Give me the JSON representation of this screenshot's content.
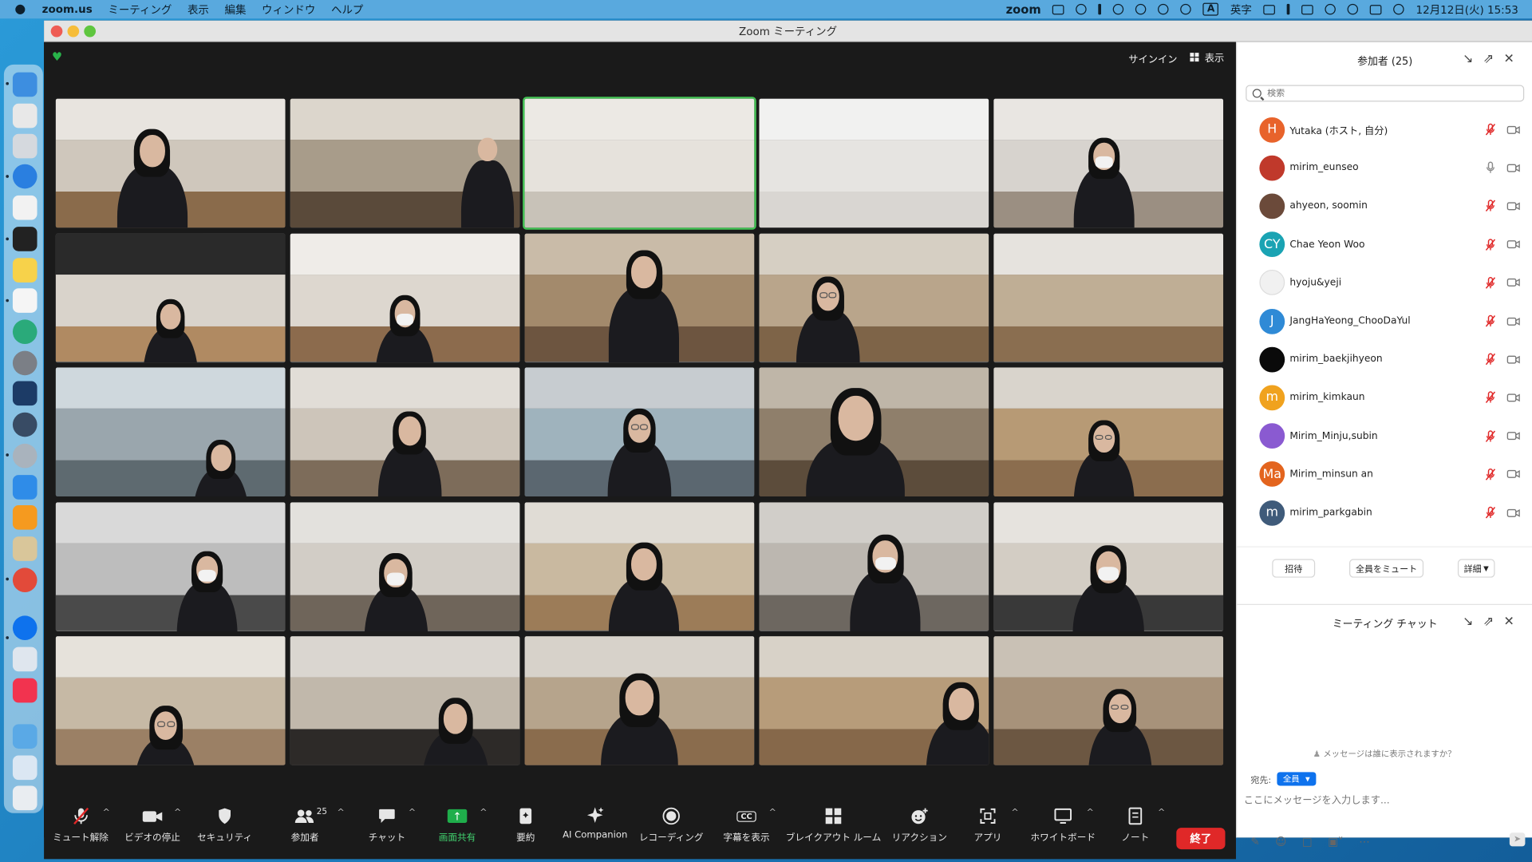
{
  "menubar": {
    "app": "zoom.us",
    "items": [
      "ミーティング",
      "表示",
      "編集",
      "ウィンドウ",
      "ヘルプ"
    ],
    "zoom_label": "zoom",
    "ime_label": "A",
    "ime_text": "英字",
    "datetime": "12月12日(火)  15:53"
  },
  "window": {
    "title": "Zoom ミーティング"
  },
  "video": {
    "signin": "サインイン",
    "view": "表示"
  },
  "toolbar": {
    "mute": "ミュート解除",
    "video": "ビデオの停止",
    "security": "セキュリティ",
    "participants": "参加者",
    "participants_count": "25",
    "chat": "チャット",
    "share": "画面共有",
    "summary": "要約",
    "ai": "AI Companion",
    "record": "レコーディング",
    "captions": "字幕を表示",
    "captions_icon": "CC",
    "breakout": "ブレイクアウト ルーム",
    "reactions": "リアクション",
    "apps": "アプリ",
    "whiteboard": "ホワイトボード",
    "notes": "ノート",
    "end": "終了"
  },
  "panel": {
    "title": "参加者 (25)",
    "search_placeholder": "検索",
    "participants": [
      {
        "name": "Yutaka (ホスト, 自分)",
        "initials": "H",
        "color": "#e8632b",
        "mic": "muted"
      },
      {
        "name": "mirim_eunseo",
        "initials": "",
        "color": "#c0392b",
        "mic": "on"
      },
      {
        "name": "ahyeon, soomin",
        "initials": "",
        "color": "#6b4a3a",
        "mic": "muted"
      },
      {
        "name": "Chae Yeon Woo",
        "initials": "CY",
        "color": "#1aa3b3",
        "mic": "muted"
      },
      {
        "name": "hyoju&yeji",
        "initials": "",
        "color": "#f1f1f1",
        "mic": "muted"
      },
      {
        "name": "JangHaYeong_ChooDaYul",
        "initials": "J",
        "color": "#2f8ad6",
        "mic": "muted"
      },
      {
        "name": "mirim_baekjihyeon",
        "initials": "",
        "color": "#0a0a0a",
        "mic": "muted"
      },
      {
        "name": "mirim_kimkaun",
        "initials": "m",
        "color": "#f0a21e",
        "mic": "muted"
      },
      {
        "name": "Mirim_Minju,subin",
        "initials": "",
        "color": "#8a5ad1",
        "mic": "muted"
      },
      {
        "name": "Mirim_minsun an",
        "initials": "Ma",
        "color": "#e3641e",
        "mic": "muted"
      },
      {
        "name": "mirim_parkgabin",
        "initials": "m",
        "color": "#3f5b7a",
        "mic": "muted"
      }
    ],
    "invite": "招待",
    "mute_all": "全員をミュート",
    "more": "詳細",
    "chat_title": "ミーティング チャット",
    "chat_note": "メッセージは誰に表示されますか？",
    "to_label": "宛先:",
    "to_value": "全員",
    "message_placeholder": "ここにメッセージを入力します..."
  },
  "colors": {
    "accent": "#0e72ed",
    "end": "#e02828",
    "share": "#1fae4b",
    "active_speaker": "#44c455"
  }
}
